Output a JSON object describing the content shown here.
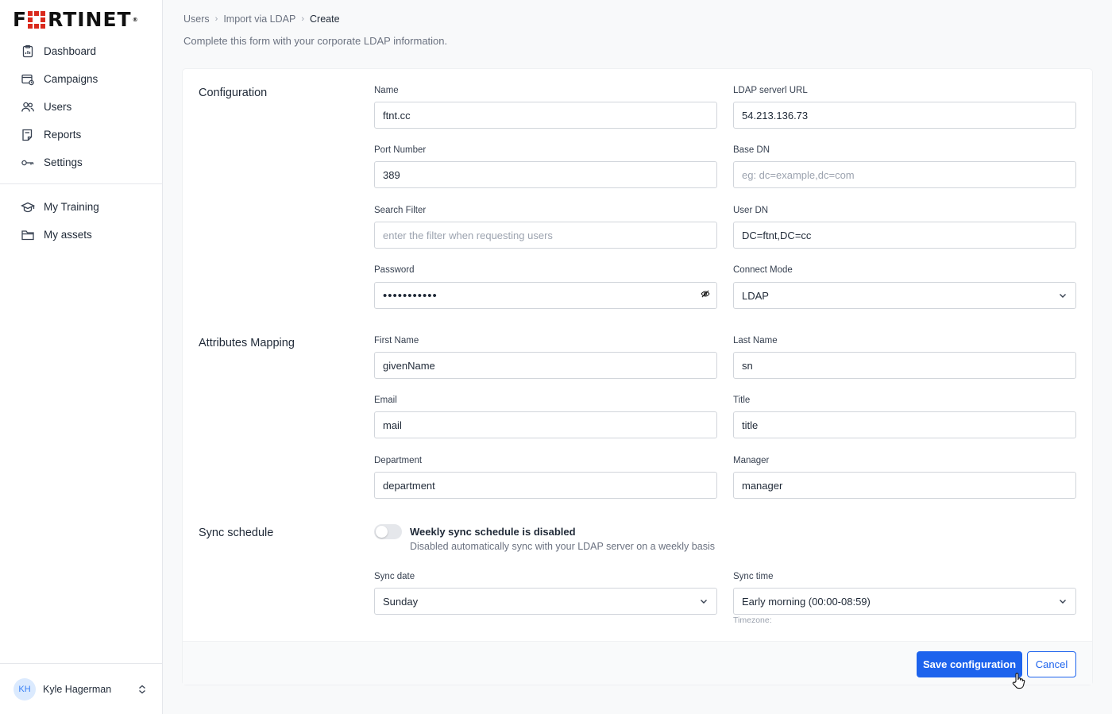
{
  "brand": {
    "logo_text_left": "F",
    "logo_text_right": "RTINET",
    "accent": "#da291c"
  },
  "sidebar": {
    "items": [
      {
        "label": "Dashboard",
        "icon": "clipboard-icon"
      },
      {
        "label": "Campaigns",
        "icon": "campaign-icon"
      },
      {
        "label": "Users",
        "icon": "users-icon"
      },
      {
        "label": "Reports",
        "icon": "report-icon"
      },
      {
        "label": "Settings",
        "icon": "key-icon"
      }
    ],
    "items2": [
      {
        "label": "My Training",
        "icon": "graduation-cap-icon"
      },
      {
        "label": "My assets",
        "icon": "folder-icon"
      }
    ],
    "user": {
      "initials": "KH",
      "name": "Kyle Hagerman"
    }
  },
  "breadcrumb": [
    "Users",
    "Import via LDAP",
    "Create"
  ],
  "subtitle": "Complete this form with your corporate LDAP information.",
  "sections": {
    "configuration": "Configuration",
    "attributes": "Attributes Mapping",
    "sync": "Sync schedule"
  },
  "fields": {
    "name": {
      "label": "Name",
      "value": "ftnt.cc",
      "placeholder": ""
    },
    "ldap_url": {
      "label": "LDAP serverl URL",
      "value": "54.213.136.73",
      "placeholder": ""
    },
    "port": {
      "label": "Port Number",
      "value": "389",
      "placeholder": ""
    },
    "base_dn": {
      "label": "Base DN",
      "value": "",
      "placeholder": "eg: dc=example,dc=com"
    },
    "search_filter": {
      "label": "Search Filter",
      "value": "",
      "placeholder": "enter the filter when requesting users"
    },
    "user_dn": {
      "label": "User DN",
      "value": "DC=ftnt,DC=cc",
      "placeholder": ""
    },
    "password": {
      "label": "Password",
      "masked": "•••••••••••"
    },
    "connect_mode": {
      "label": "Connect Mode",
      "value": "LDAP"
    },
    "first_name": {
      "label": "First Name",
      "value": "givenName"
    },
    "last_name": {
      "label": "Last Name",
      "value": "sn"
    },
    "email": {
      "label": "Email",
      "value": "mail"
    },
    "title": {
      "label": "Title",
      "value": "title"
    },
    "department": {
      "label": "Department",
      "value": "department"
    },
    "manager": {
      "label": "Manager",
      "value": "manager"
    },
    "sync_date": {
      "label": "Sync date",
      "value": "Sunday"
    },
    "sync_time": {
      "label": "Sync time",
      "value": "Early morning (00:00-08:59)"
    }
  },
  "sync": {
    "enabled": false,
    "title": "Weekly sync schedule is disabled",
    "description": "Disabled automatically sync with your LDAP server on a weekly basis",
    "timezone_label": "Timezone:"
  },
  "buttons": {
    "save": "Save configuration",
    "cancel": "Cancel",
    "primary_color": "#1d63ed"
  }
}
